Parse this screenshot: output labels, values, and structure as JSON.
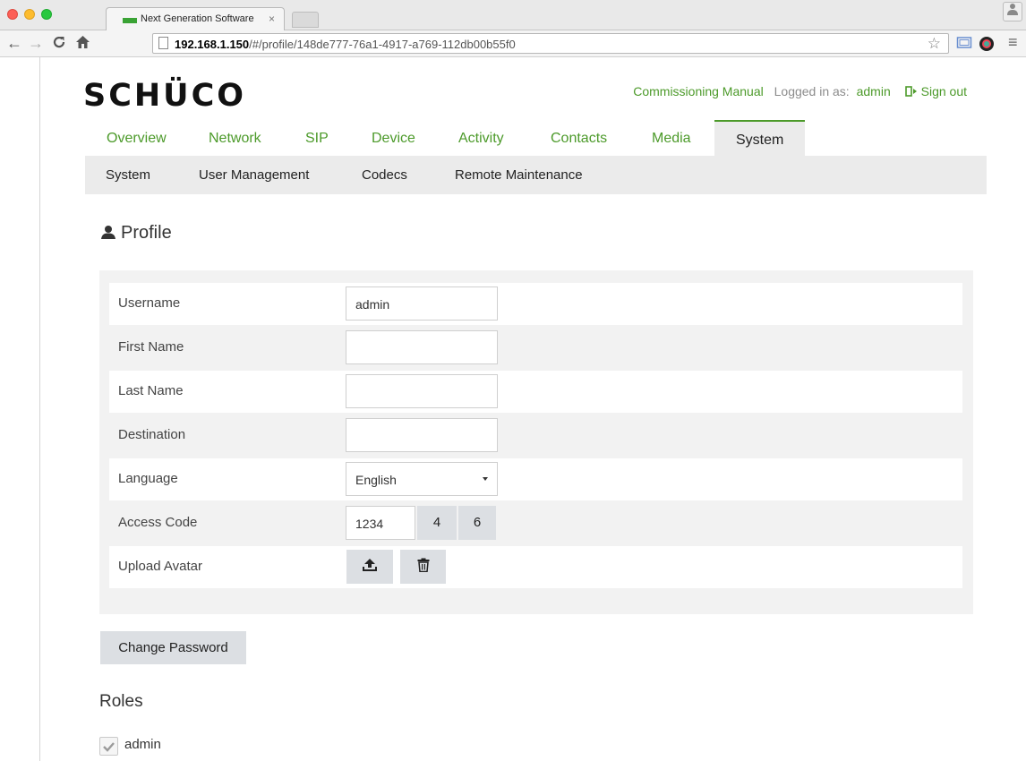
{
  "browser": {
    "tab_title": "Next Generation Software",
    "tab_close": "×",
    "url_host": "192.168.1.150",
    "url_path": "/#/profile/148de777-76a1-4917-a769-112db00b55f0"
  },
  "header": {
    "logo": "SCHÜCO",
    "manual_link": "Commissioning Manual",
    "logged_in_label": "Logged in as:",
    "user": "admin",
    "sign_out": "Sign out"
  },
  "main_nav": [
    "Overview",
    "Network",
    "SIP",
    "Device",
    "Activity",
    "Contacts",
    "Media",
    "System"
  ],
  "sub_nav": [
    "System",
    "User Management",
    "Codecs",
    "Remote Maintenance"
  ],
  "profile": {
    "title": "Profile",
    "fields": {
      "username_label": "Username",
      "username_value": "admin",
      "first_name_label": "First Name",
      "last_name_label": "Last Name",
      "destination_label": "Destination",
      "language_label": "Language",
      "language_value": "English",
      "access_code_label": "Access Code",
      "access_code_value": "1234",
      "access_code_btn_1": "4",
      "access_code_btn_2": "6",
      "upload_avatar_label": "Upload Avatar"
    }
  },
  "change_password": "Change Password",
  "roles": {
    "title": "Roles",
    "items": [
      {
        "label": "admin",
        "checked": true
      }
    ]
  },
  "colors": {
    "accent": "#4c9a2a",
    "nav_bg": "#ebebeb",
    "button_bg": "#dcdfe3"
  }
}
